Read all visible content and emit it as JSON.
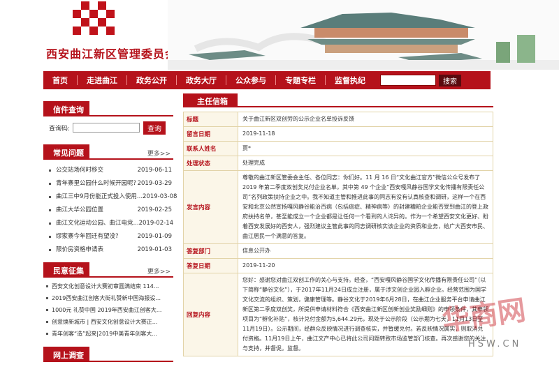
{
  "header": {
    "site_title": "西安曲江新区管理委员会"
  },
  "nav": {
    "items": [
      "首页",
      "走进曲江",
      "政务公开",
      "政务大厅",
      "公众参与",
      "专题专栏",
      "监督执纪"
    ],
    "search_label": "搜索"
  },
  "letter_query": {
    "title": "信件查询",
    "label": "查询码:",
    "button": "查询"
  },
  "faq": {
    "title": "常见问题",
    "more": "更多>>",
    "items": [
      {
        "text": "公交站场何时移交",
        "date": "2019-06-11"
      },
      {
        "text": "青年寨里公园什么时候开园呢?",
        "date": "2019-03-29"
      },
      {
        "text": "曲江三中9月份能正式投入使用...",
        "date": "2019-03-08"
      },
      {
        "text": "曲江大华公园位置",
        "date": "2019-02-25"
      },
      {
        "text": "曲江文化运动公园、曲江电竞...",
        "date": "2019-02-14"
      },
      {
        "text": "缪家寨今年回迁有望没?",
        "date": "2019-01-09"
      },
      {
        "text": "限价房资格申请表",
        "date": "2019-01-03"
      }
    ]
  },
  "opinions": {
    "title": "民意征集",
    "more": "更多>>",
    "items": [
      "西安文化创意设计大赛初审圆满结束 114...",
      "2019西安曲江创客大街礼赞新中国海报设...",
      "1000元 礼赞中国 2019年西安曲江创客大...",
      "创意焕新城市 | 西安文化创意设计大赛正...",
      "青年创客“造”起来|2019中美青年创客大..."
    ]
  },
  "survey": {
    "title": "网上调查"
  },
  "mailbox": {
    "title": "主任信箱",
    "rows": [
      {
        "label": "标题",
        "value": "关于曲江新区双创劳的公示企业名单投诉反馈"
      },
      {
        "label": "留言日期",
        "value": "2019-11-18"
      },
      {
        "label": "联系人姓名",
        "value": "贾*"
      },
      {
        "label": "处理状态",
        "value": "处理完成"
      },
      {
        "label": "发言内容",
        "value": "尊敬的曲江新区管委会主任、各位同志：你们好。11 月 16 日“文化曲江官方”微信公众号发布了 2019 年第二季度双创奖兑付企业名单，其中第 49 个企业“西安嘎风静谷国学文化传播有限责任公司”名列政策扶持企业之中。我不知道主管和推进此事的同志有没有认真核查和调研，这样一个在西安和北京公然宣扬嘎风静谷能治百病（包括癌症、精神病等）的封建糟粕企业能否受到曲江的登上政府扶持名单，甚至能成立一个企业都是让任何一个看到的人诧异的。作为一个希望西安文化更好、盼着西安发展好的西安人，强烈建议主管此事的同志调研核实该企业的资质和业务，给广大西安市民、曲江居民一个满意的答复。"
      },
      {
        "label": "答复部门",
        "value": "信息公开办"
      },
      {
        "label": "答复日期",
        "value": "2019-11-20"
      },
      {
        "label": "回复内容",
        "value": "您好：感谢您对曲江双创工作的关心与支持。经查，“西安嘎风静谷国学文化传播有限责任公司”（以下简称“静谷文化”），于2017年11月24日成立注册，属于涉文创企业园入孵企业。经营范围为国学文化交流的组织、策划，健康管理等。静谷文化于2019年6月28日，在曲江企业服务平台申请曲江新区第二季度双创奖，所提供申请材料符合《西安曲江新区创新创业奖励细则》的申领条件，其申领项目为“孵化补贴”，核计兑付金额为5,644.29元，现处于公示阶段（公示期为七天，11月13日至11月19日）。公示期间，经群众反映情况进行调查核实，并暂缓兑付。若反映情况属实，则取消兑付资格。11月19日上午，曲江文产中心已将此公司问题转致市场监管部门核查。再次感谢您的关注与支持，并督促。监督。"
      }
    ]
  },
  "watermark": {
    "text": "华商网",
    "url": "HSW.CN"
  },
  "colors": {
    "brand_red": "#b5121b",
    "table_border": "#e2d3a8"
  }
}
